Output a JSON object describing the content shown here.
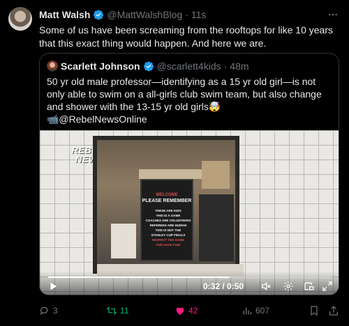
{
  "tweet": {
    "author_name": "Matt Walsh",
    "author_handle": "@MattWalshBlog",
    "separator": "·",
    "time": "11s",
    "text": "Some of us have been screaming from the rooftops for like 10 years that this exact thing would happen. And here we are.",
    "verified_color": "#1d9bf0"
  },
  "quote": {
    "author_name": "Scarlett Johnson",
    "author_handle": "@scarlett4kids",
    "separator": "·",
    "time": "48m",
    "text_line": "50 yr old male professor—identifying as a 15 yr old girl—is not only able to swim on a all-girls club swim team, but also change and shower with the 13-15 yr old girls🤯",
    "credit": "📹@RebelNewsOnline"
  },
  "video": {
    "logo_line1": "REBEL",
    "logo_line2": "NEWS",
    "sign_welcome": "WELCOME",
    "sign_title": "PLEASE REMEMBER",
    "sign_lines": [
      "THESE ARE KIDS",
      "THIS IS A GAME",
      "COACHES ARE VOLUNTEERS",
      "REFEREES ARE HUMAN",
      "THIS IS NOT THE",
      "STANLEY CUP FINALS"
    ],
    "sign_footer_1": "RESPECT THE GAME",
    "sign_footer_2": "AND HAVE FUN!",
    "timecode": "0:32 / 0:50",
    "progress": 0.64,
    "icons": [
      "play-icon",
      "mute-icon",
      "settings-icon",
      "pip-icon",
      "fullscreen-icon"
    ]
  },
  "actions": {
    "replies": "3",
    "retweets": "11",
    "likes": "42",
    "views": "607",
    "retweet_color": "#00ba7c",
    "like_color": "#f91880"
  }
}
